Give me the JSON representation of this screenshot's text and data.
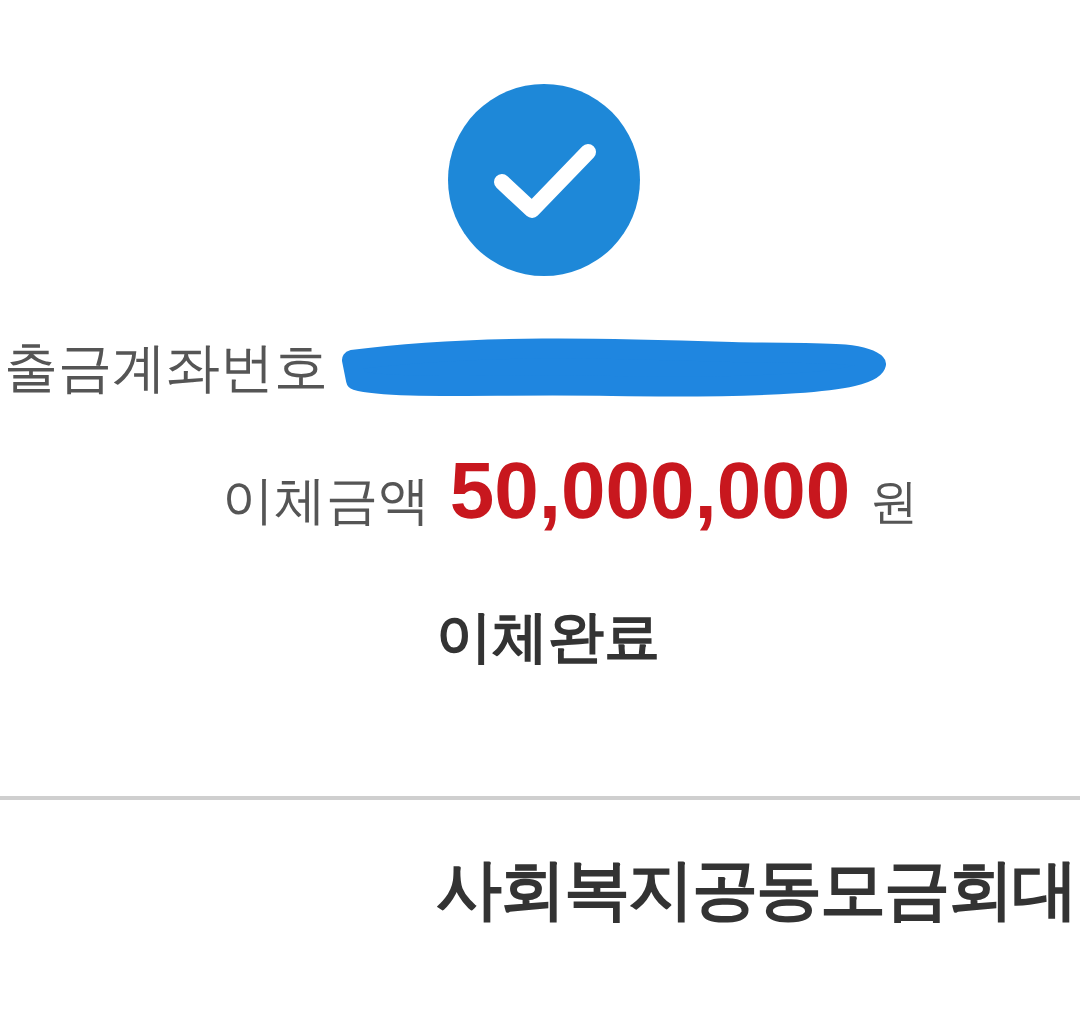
{
  "account": {
    "label": "출금계좌번호",
    "redacted": true
  },
  "amount": {
    "label": "이체금액",
    "value": "50,000,000",
    "unit": "원"
  },
  "status": "이체완료",
  "recipient": "사회복지공동모금회대"
}
